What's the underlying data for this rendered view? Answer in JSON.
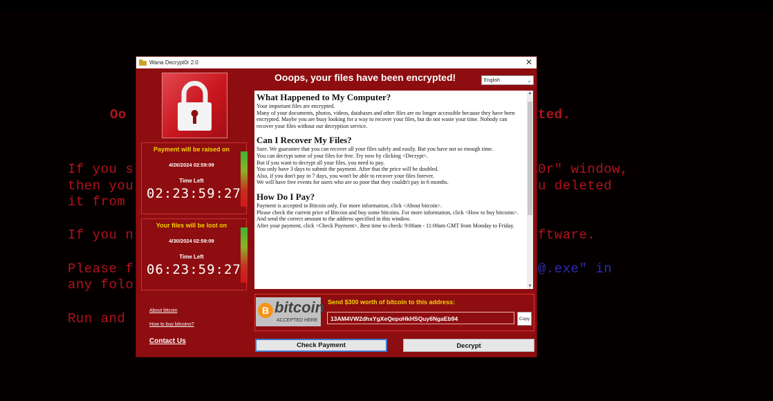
{
  "background": {
    "line1_left": "Oo",
    "line1_right": "ted.",
    "line2_left": "If you s",
    "line2_right": "0r\" window,",
    "line3_left": "then you",
    "line3_right": "u deleted",
    "line4_left": "it from",
    "line5_left": "If you n",
    "line5_right": "ftware.",
    "line6_left": "Please f",
    "line6_right": "@.exe\" in",
    "line7_left": "any folo",
    "line8_left": "Run and"
  },
  "window": {
    "title": "Wana Decrypt0r 2.0",
    "header": "Ooops, your files have been encrypted!",
    "language": "English"
  },
  "timer1": {
    "title": "Payment will be raised on",
    "date": "4/26/2024 02:59:09",
    "label": "Time Left",
    "clock": "02:23:59:27"
  },
  "timer2": {
    "title": "Your files will be lost on",
    "date": "4/30/2024 02:59:09",
    "label": "Time Left",
    "clock": "06:23:59:27"
  },
  "links": {
    "about_bitcoin": "About bitcoin",
    "how_to_buy": "How to buy bitcoins?",
    "contact": "Contact Us"
  },
  "text": {
    "h1": "What Happened to My Computer?",
    "s1": [
      "Your important files are encrypted.",
      "Many of your documents, photos, videos, databases and other files are no longer accessible because they have been encrypted. Maybe you are busy looking for a way to recover your files, but do not waste your time. Nobody can recover your files without our decryption service."
    ],
    "h2": "Can I Recover My Files?",
    "s2": [
      "Sure. We guarantee that you can recover all your files safely and easily. But you have not so enough time.",
      "You can decrypt some of your files for free. Try now by clicking <Decrypt>.",
      "But if you want to decrypt all your files, you need to pay.",
      "You only have 3 days to submit the payment. After that the price will be doubled.",
      "Also, if you don't pay in 7 days, you won't be able to recover your files forever.",
      "We will have free events for users who are so poor that they couldn't pay in 6 months."
    ],
    "h3": "How Do I Pay?",
    "s3": [
      "Payment is accepted in Bitcoin only. For more information, click <About bitcoin>.",
      "Please check the current price of Bitcoin and buy some bitcoins. For more information, click <How to buy bitcoins>.",
      "And send the correct amount to the address specified in this window.",
      "After your payment, click <Check Payment>. Best time to check: 9:00am - 11:00am GMT from Monday to Friday."
    ]
  },
  "bitcoin": {
    "logo_symbol": "B",
    "logo_word": "bitcoin",
    "logo_sub": "ACCEPTED HERE",
    "send_label": "Send $300 worth of bitcoin to this address:",
    "address": "13AM4VW2dhxYgXeQepoHkHSQuy6NgaEb94",
    "copy": "Copy"
  },
  "buttons": {
    "check_payment": "Check Payment",
    "decrypt": "Decrypt"
  },
  "colors": {
    "window_bg": "#8e0d10",
    "accent_yellow": "#f4d400",
    "bg_text_red": "#b3121c",
    "bg_text_blue": "#2a2bb5"
  }
}
